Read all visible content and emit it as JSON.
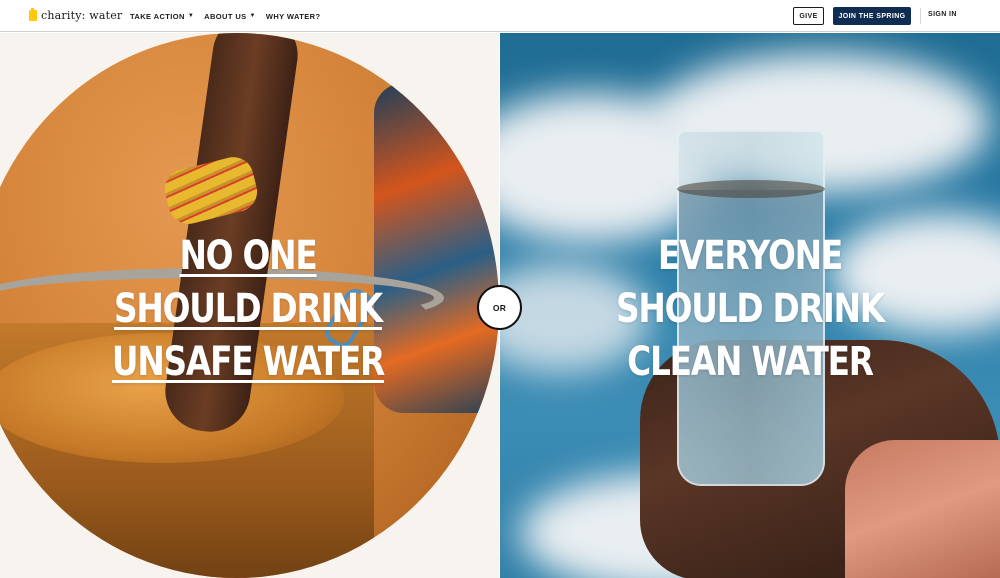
{
  "brand": {
    "name": "charity: water",
    "logo_icon": "jerrycan-icon",
    "accent": "#ffc907"
  },
  "nav": {
    "items": [
      {
        "label": "TAKE ACTION",
        "has_dropdown": true
      },
      {
        "label": "ABOUT US",
        "has_dropdown": true
      },
      {
        "label": "WHY WATER?",
        "has_dropdown": false
      }
    ],
    "give_label": "GIVE",
    "spring_label": "JOIN THE SPRING",
    "spring_color": "#0f2d52",
    "signin_label": "SIGN IN"
  },
  "hero": {
    "left_lines": [
      "NO ONE",
      "SHOULD DRINK",
      "UNSAFE WATER"
    ],
    "right_lines": [
      "EVERYONE",
      "SHOULD DRINK",
      "CLEAN WATER"
    ],
    "divider_label": "OR"
  }
}
